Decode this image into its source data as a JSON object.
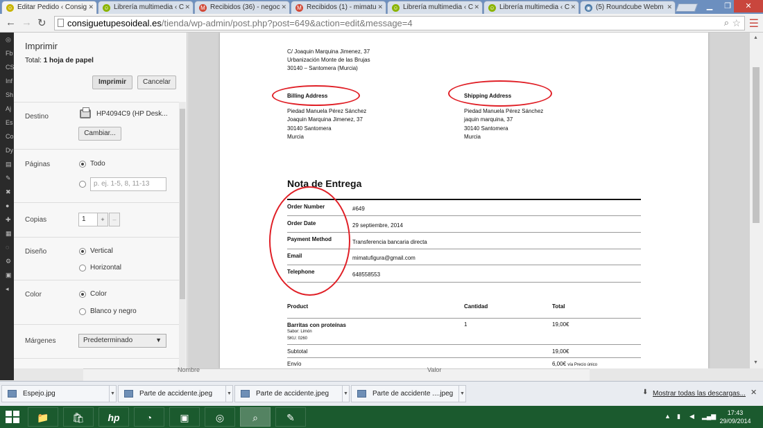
{
  "tabs": [
    {
      "label": "Editar Pedido ‹ Consig",
      "icon_color": "#c8b400",
      "active": true
    },
    {
      "label": "Librería multimedia ‹ C",
      "icon_color": "#8bb400",
      "active": false
    },
    {
      "label": "Recibidos (36) - negoc",
      "icon_color": "#d14836",
      "active": false
    },
    {
      "label": "Recibidos (1) - mimatu",
      "icon_color": "#d14836",
      "active": false
    },
    {
      "label": "Librería multimedia ‹ C",
      "icon_color": "#8bb400",
      "active": false
    },
    {
      "label": "Librería multimedia ‹ C",
      "icon_color": "#8bb400",
      "active": false
    },
    {
      "label": "(5) Roundcube Webm",
      "icon_color": "#4d7ba8",
      "active": false
    }
  ],
  "window_controls": {
    "minimize": "▁",
    "maximize": "❐",
    "close": "✕"
  },
  "address": {
    "domain": "consiguetupesoideal.es",
    "path": "/tienda/wp-admin/post.php?post=649&action=edit&message=4"
  },
  "wp_sidebar": [
    "Fb",
    "CS",
    "Inf",
    "Sh",
    "Aj",
    "Es",
    "Co",
    "Dy"
  ],
  "print": {
    "title": "Imprimir",
    "total_prefix": "Total:",
    "total_value": "1 hoja de papel",
    "print_button": "Imprimir",
    "cancel_button": "Cancelar",
    "destino_label": "Destino",
    "printer_name": "HP4094C9 (HP Desk...",
    "change_button": "Cambiar...",
    "paginas_label": "Páginas",
    "pages_all": "Todo",
    "pages_placeholder": "p. ej. 1-5, 8, 11-13",
    "copias_label": "Copias",
    "copies_value": "1",
    "copies_plus": "+",
    "copies_minus": "–",
    "diseno_label": "Diseño",
    "layout_vertical": "Vertical",
    "layout_horizontal": "Horizontal",
    "color_label": "Color",
    "color_color": "Color",
    "color_bw": "Blanco y negro",
    "margenes_label": "Márgenes",
    "margins_value": "Predeterminado"
  },
  "document": {
    "address_lines": [
      "C/ Joaquin Marquina Jimenez, 37",
      "Urbanización Monte de las Brujas",
      "30140 – Santomera (Murcia)"
    ],
    "billing_title": "Billing Address",
    "billing_lines": [
      "Piedad Manuela Pérez Sánchez",
      "Joaquin Marquina Jimenez, 37",
      "30140 Santomera",
      "Murcia"
    ],
    "shipping_title": "Shipping Address",
    "shipping_lines": [
      "Piedad Manuela Pérez Sánchez",
      "jaquin marquina, 37",
      "30140 Santomera",
      "Murcia"
    ],
    "heading": "Nota de Entrega",
    "order_rows": [
      {
        "label": "Order Number",
        "value": "#649"
      },
      {
        "label": "Order Date",
        "value": "29 septiembre, 2014"
      },
      {
        "label": "Payment Method",
        "value": "Transferencia bancaria directa"
      },
      {
        "label": "Email",
        "value": "mimatufigura@gmail.com"
      },
      {
        "label": "Telephone",
        "value": "648558553"
      }
    ],
    "product_headers": {
      "product": "Product",
      "quantity": "Cantidad",
      "total": "Total"
    },
    "product": {
      "name": "Barritas con proteínas",
      "meta1": "Sabor: Limón",
      "meta2": "SKU: 0260",
      "quantity": "1",
      "total": "19,00€"
    },
    "subtotal_label": "Subtotal",
    "subtotal_value": "19,00€",
    "shipping_label": "Envío",
    "shipping_value": "6,00€",
    "shipping_note": "vía Precio único"
  },
  "behind": {
    "left": "Nombre",
    "right": "Valor"
  },
  "downloads": [
    "Espejo.jpg",
    "Parte de accidente.jpeg",
    "Parte de accidente.jpeg",
    "Parte de accidente ....jpeg"
  ],
  "show_all_downloads": "Mostrar todas las descargas...",
  "taskbar": {
    "time": "17:43",
    "date": "29/09/2014",
    "hp_label": "hp"
  },
  "colors": {
    "annotation": "#e01f26",
    "taskbar": "#1b5a2e",
    "tabstrip": "#6c8fbf"
  }
}
